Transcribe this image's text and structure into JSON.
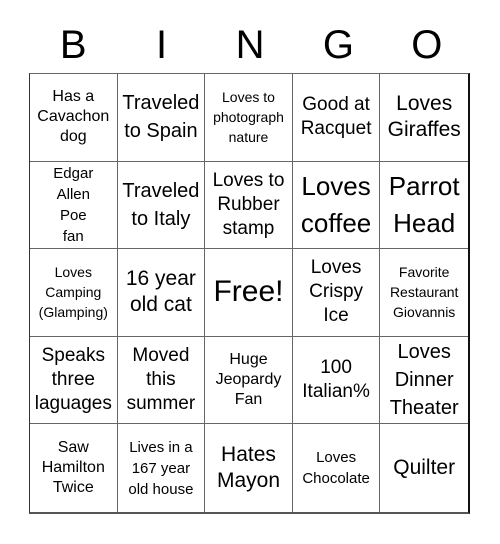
{
  "header": {
    "letters": [
      "B",
      "I",
      "N",
      "G",
      "O"
    ]
  },
  "cells": [
    "Has a\nCavachon\ndog",
    "Traveled\nto Spain",
    "Loves to\nphotograph\nnature",
    "Good at\nRacquet",
    "Loves\nGiraffes",
    "Edgar\nAllen\nPoe\nfan",
    "Traveled\nto Italy",
    "Loves to\nRubber\nstamp",
    "Loves\ncoffee",
    "Parrot\nHead",
    "Loves\nCamping\n(Glamping)",
    "16 year\nold cat",
    "Free!",
    "Loves\nCrispy\nIce",
    "Favorite\nRestaurant\nGiovannis",
    "Speaks\nthree\nlaguages",
    "Moved\nthis\nsummer",
    "Huge\nJeopardy\nFan",
    "100\nItalian%",
    "Loves\nDinner\nTheater",
    "Saw\nHamilton\nTwice",
    "Lives in a\n167 year\nold house",
    "Hates\nMayon",
    "Loves\nChocolate",
    "Quilter"
  ]
}
